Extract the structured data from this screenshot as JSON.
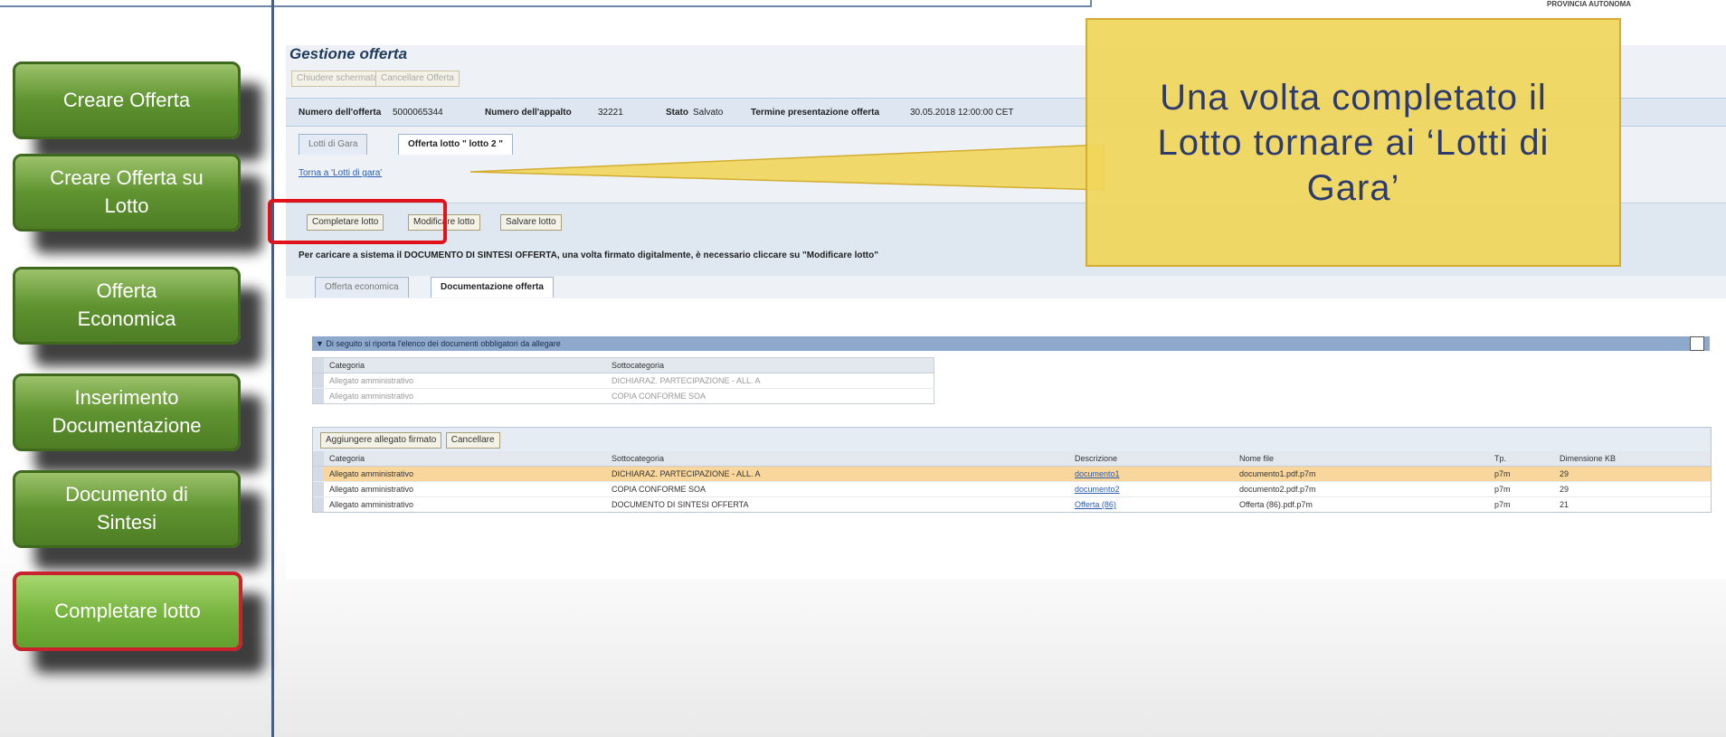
{
  "sidebar": {
    "items": [
      {
        "label": "Creare Offerta",
        "active": false
      },
      {
        "label": "Creare Offerta su Lotto",
        "active": false
      },
      {
        "label": "Offerta Economica",
        "active": false
      },
      {
        "label": "Inserimento Documentazione",
        "active": false
      },
      {
        "label": "Documento di Sintesi",
        "active": false
      },
      {
        "label": "Completare lotto",
        "active": true
      }
    ]
  },
  "logo_text": "PROVINCIA AUTONOMA",
  "app": {
    "title": "Gestione offerta",
    "toolbar": {
      "close_label": "Chiudere schermata",
      "cancel_offer_label": "Cancellare Offerta"
    },
    "info": {
      "offer_number_label": "Numero dell'offerta",
      "offer_number": "5000065344",
      "tender_number_label": "Numero dell'appalto",
      "tender_number": "32221",
      "status_label": "Stato",
      "status": "Salvato",
      "deadline_label": "Termine presentazione offerta",
      "deadline": "30.05.2018 12:00:00 CET"
    },
    "tabs": [
      {
        "label": "Lotti di Gara",
        "selected": false
      },
      {
        "label": "Offerta lotto \" lotto 2 \"",
        "selected": true
      }
    ],
    "back_link": "Torna a 'Lotti di gara'",
    "lot_actions": {
      "complete": "Completare lotto",
      "modify": "Modificare lotto",
      "save": "Salvare lotto"
    },
    "notice": "Per caricare a sistema il DOCUMENTO DI SINTESI OFFERTA, una volta firmato digitalmente, è necessario cliccare su \"Modificare lotto\"",
    "subtabs": [
      {
        "label": "Offerta economica",
        "selected": false
      },
      {
        "label": "Documentazione offerta",
        "selected": true
      }
    ],
    "section_header": "▼ Di seguito si riporta l'elenco dei documenti obbligatori da allegare",
    "required_docs": {
      "headers": [
        "Categoria",
        "Sottocategoria"
      ],
      "rows": [
        [
          "Allegato amministrativo",
          "DICHIARAZ. PARTECIPAZIONE - ALL. A"
        ],
        [
          "Allegato amministrativo",
          "COPIA CONFORME SOA"
        ]
      ]
    },
    "attachments_toolbar": {
      "add": "Aggiungere allegato firmato",
      "delete": "Cancellare"
    },
    "attachments": {
      "headers": [
        "Categoria",
        "Sottocategoria",
        "Descrizione",
        "Nome file",
        "Tp.",
        "Dimensione KB"
      ],
      "rows": [
        [
          "Allegato amministrativo",
          "DICHIARAZ. PARTECIPAZIONE - ALL. A",
          "documento1",
          "documento1.pdf.p7m",
          "p7m",
          "29"
        ],
        [
          "Allegato amministrativo",
          "COPIA CONFORME SOA",
          "documento2",
          "documento2.pdf.p7m",
          "p7m",
          "29"
        ],
        [
          "Allegato amministrativo",
          "DOCUMENTO DI SINTESI OFFERTA",
          "Offerta (86)",
          "Offerta (86).pdf.p7m",
          "p7m",
          "21"
        ]
      ]
    }
  },
  "callout": {
    "text": "Una volta completato il Lotto tornare ai ‘Lotti di Gara’"
  },
  "colors": {
    "nav_green": "#5f9330",
    "highlight_red": "#e1121b",
    "callout_yellow": "#f0d65a"
  }
}
